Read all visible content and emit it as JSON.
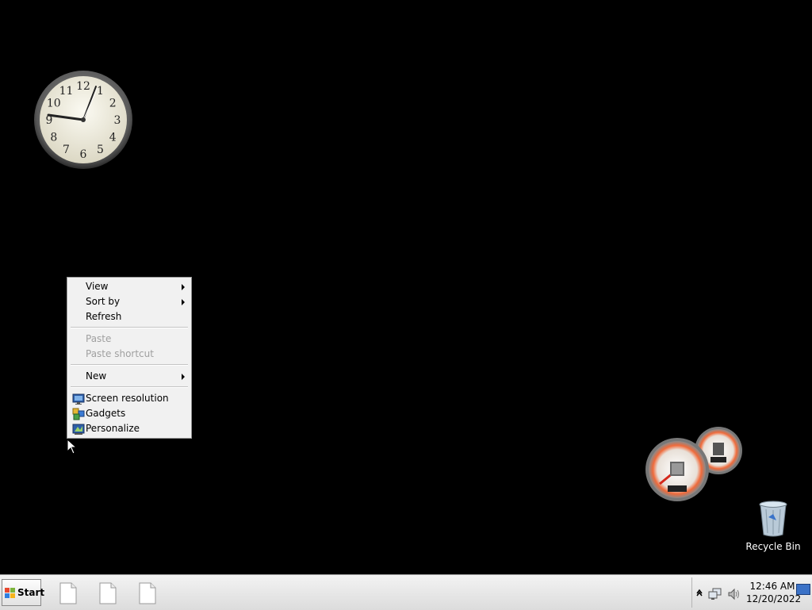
{
  "desktop": {
    "recycle_bin_label": "Recycle Bin"
  },
  "clock_gadget": {
    "numerals": [
      "12",
      "1",
      "2",
      "3",
      "4",
      "5",
      "6",
      "7",
      "8",
      "9",
      "10",
      "11"
    ],
    "time_shown": "12:46"
  },
  "context_menu": {
    "items": [
      {
        "label": "View",
        "submenu": true,
        "disabled": false
      },
      {
        "label": "Sort by",
        "submenu": true,
        "disabled": false
      },
      {
        "label": "Refresh",
        "submenu": false,
        "disabled": false
      },
      {
        "label": "Paste",
        "submenu": false,
        "disabled": true
      },
      {
        "label": "Paste shortcut",
        "submenu": false,
        "disabled": true
      },
      {
        "label": "New",
        "submenu": true,
        "disabled": false
      },
      {
        "label": "Screen resolution",
        "icon": "monitor-icon",
        "submenu": false,
        "disabled": false
      },
      {
        "label": "Gadgets",
        "icon": "gadgets-icon",
        "submenu": false,
        "disabled": false
      },
      {
        "label": "Personalize",
        "icon": "personalize-icon",
        "submenu": false,
        "disabled": false
      }
    ]
  },
  "taskbar": {
    "start_label": "Start",
    "time": "12:46 AM",
    "date": "12/20/2022"
  }
}
